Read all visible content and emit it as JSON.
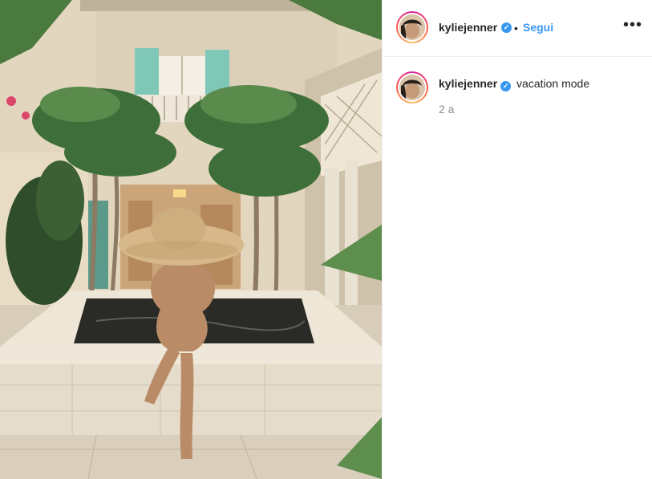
{
  "post": {
    "author": {
      "username": "kyliejenner",
      "verified": true
    },
    "header": {
      "separator": "•",
      "follow_label": "Segui",
      "more_label": "•••"
    },
    "caption": {
      "username": "kyliejenner",
      "text": "vacation mode",
      "timestamp": "2 a"
    },
    "colors": {
      "link_blue": "#3897f0",
      "verified_blue": "#3897f0",
      "text": "#262626",
      "muted": "#8e8e8e",
      "divider": "#efefef"
    },
    "icons": {
      "verified": "verified-badge-icon",
      "more": "more-options-icon"
    }
  }
}
